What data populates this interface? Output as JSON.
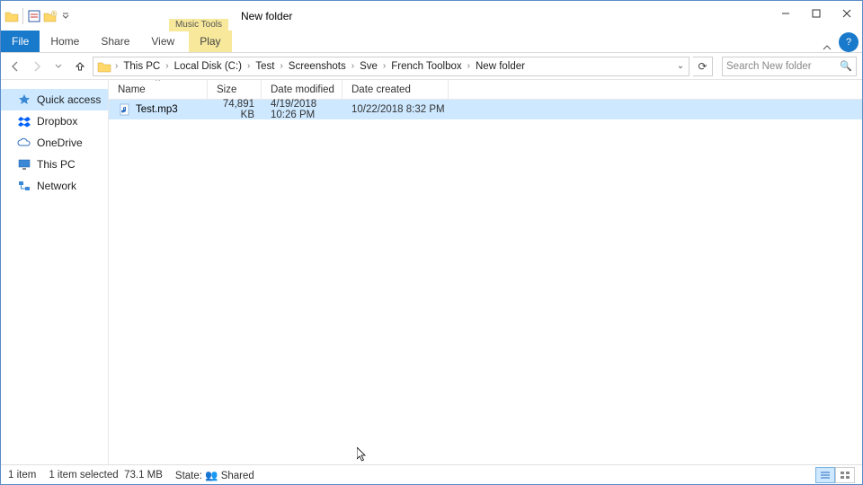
{
  "title": "New folder",
  "context_tab_caption": "Music Tools",
  "ribbon": {
    "file": "File",
    "home": "Home",
    "share": "Share",
    "view": "View",
    "play": "Play"
  },
  "breadcrumb": [
    "This PC",
    "Local Disk (C:)",
    "Test",
    "Screenshots",
    "Sve",
    "French Toolbox",
    "New folder"
  ],
  "search_placeholder": "Search New folder",
  "nav": {
    "quick_access": "Quick access",
    "dropbox": "Dropbox",
    "onedrive": "OneDrive",
    "this_pc": "This PC",
    "network": "Network"
  },
  "columns": {
    "name": "Name",
    "size": "Size",
    "modified": "Date modified",
    "created": "Date created"
  },
  "rows": [
    {
      "name": "Test.mp3",
      "size": "74,891 KB",
      "modified": "4/19/2018 10:26 PM",
      "created": "10/22/2018 8:32 PM"
    }
  ],
  "status": {
    "count": "1 item",
    "selected": "1 item selected",
    "selsize": "73.1 MB",
    "state_label": "State:",
    "state_value": "Shared"
  }
}
